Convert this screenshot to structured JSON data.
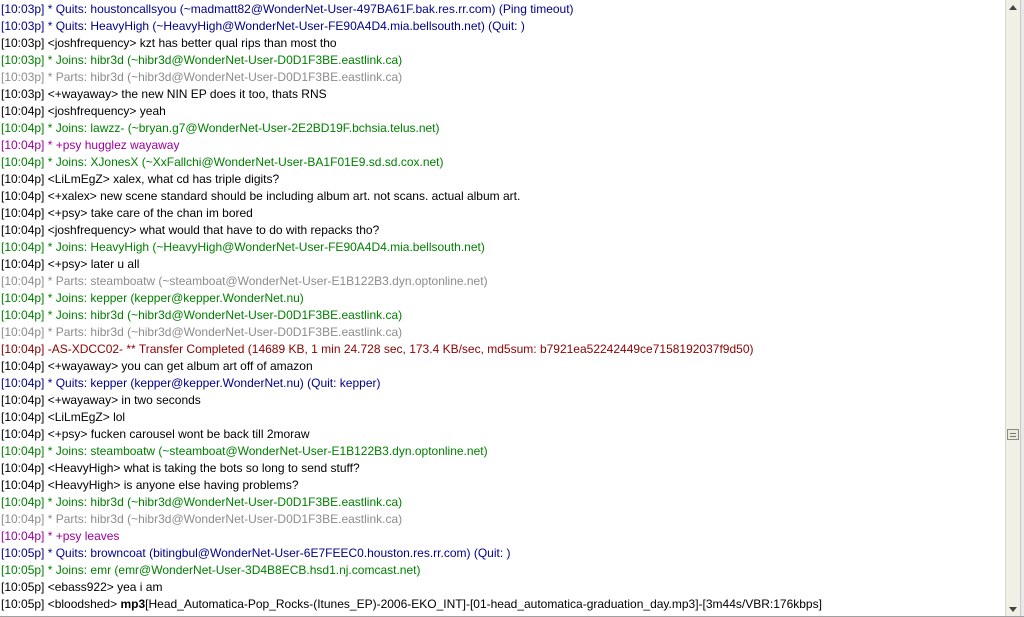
{
  "lines": [
    {
      "ts": "[10:03p]",
      "type": "quit",
      "text": " * Quits: houstoncallsyou (~madmatt82@WonderNet-User-497BA61F.bak.res.rr.com) (Ping timeout)"
    },
    {
      "ts": "[10:03p]",
      "type": "quit",
      "text": " * Quits: HeavyHigh (~HeavyHigh@WonderNet-User-FE90A4D4.mia.bellsouth.net) (Quit: )"
    },
    {
      "ts": "[10:03p]",
      "type": "normal",
      "text": " <joshfrequency> kzt has better qual rips than most tho"
    },
    {
      "ts": "[10:03p]",
      "type": "join",
      "text": " * Joins: hibr3d (~hibr3d@WonderNet-User-D0D1F3BE.eastlink.ca)"
    },
    {
      "ts": "[10:03p]",
      "type": "part",
      "text": " * Parts: hibr3d (~hibr3d@WonderNet-User-D0D1F3BE.eastlink.ca)"
    },
    {
      "ts": "[10:03p]",
      "type": "normal",
      "text": " <+wayaway> the new NIN EP does it too, thats RNS"
    },
    {
      "ts": "[10:04p]",
      "type": "normal",
      "text": " <joshfrequency> yeah"
    },
    {
      "ts": "[10:04p]",
      "type": "join",
      "text": " * Joins: lawzz- (~bryan.g7@WonderNet-User-2E2BD19F.bchsia.telus.net)"
    },
    {
      "ts": "[10:04p]",
      "type": "action",
      "text": " * +psy hugglez wayaway"
    },
    {
      "ts": "[10:04p]",
      "type": "join",
      "text": " * Joins: XJonesX (~XxFallchi@WonderNet-User-BA1F01E9.sd.sd.cox.net)"
    },
    {
      "ts": "[10:04p]",
      "type": "normal",
      "text": " <LiLmEgZ> xalex, what cd has triple digits?"
    },
    {
      "ts": "[10:04p]",
      "type": "normal",
      "text": " <+xalex> new scene standard should be including album art. not scans. actual album art."
    },
    {
      "ts": "[10:04p]",
      "type": "normal",
      "text": " <+psy> take care of the chan im bored"
    },
    {
      "ts": "[10:04p]",
      "type": "normal",
      "text": " <joshfrequency> what would that have to do with repacks tho?"
    },
    {
      "ts": "[10:04p]",
      "type": "join",
      "text": " * Joins: HeavyHigh (~HeavyHigh@WonderNet-User-FE90A4D4.mia.bellsouth.net)"
    },
    {
      "ts": "[10:04p]",
      "type": "normal",
      "text": " <+psy> later u all"
    },
    {
      "ts": "[10:04p]",
      "type": "part",
      "text": " * Parts: steamboatw (~steamboat@WonderNet-User-E1B122B3.dyn.optonline.net)"
    },
    {
      "ts": "[10:04p]",
      "type": "join",
      "text": " * Joins: kepper (kepper@kepper.WonderNet.nu)"
    },
    {
      "ts": "[10:04p]",
      "type": "join",
      "text": " * Joins: hibr3d (~hibr3d@WonderNet-User-D0D1F3BE.eastlink.ca)"
    },
    {
      "ts": "[10:04p]",
      "type": "part",
      "text": " * Parts: hibr3d (~hibr3d@WonderNet-User-D0D1F3BE.eastlink.ca)"
    },
    {
      "ts": "[10:04p]",
      "type": "notice",
      "text": " -AS-XDCC02- ** Transfer Completed (14689 KB, 1 min 24.728 sec, 173.4 KB/sec, md5sum: b7921ea52242449ce7158192037f9d50)"
    },
    {
      "ts": "[10:04p]",
      "type": "normal",
      "text": " <+wayaway> you can get album art off of amazon"
    },
    {
      "ts": "[10:04p]",
      "type": "quit",
      "text": " * Quits: kepper (kepper@kepper.WonderNet.nu) (Quit: kepper)"
    },
    {
      "ts": "[10:04p]",
      "type": "normal",
      "text": " <+wayaway> in two seconds"
    },
    {
      "ts": "[10:04p]",
      "type": "normal",
      "text": " <LiLmEgZ> lol"
    },
    {
      "ts": "[10:04p]",
      "type": "normal",
      "text": " <+psy> fucken carousel wont be back till 2moraw"
    },
    {
      "ts": "[10:04p]",
      "type": "join",
      "text": " * Joins: steamboatw (~steamboat@WonderNet-User-E1B122B3.dyn.optonline.net)"
    },
    {
      "ts": "[10:04p]",
      "type": "normal",
      "text": " <HeavyHigh> what is taking the bots so long to send stuff?"
    },
    {
      "ts": "[10:04p]",
      "type": "normal",
      "text": " <HeavyHigh> is anyone else having problems?"
    },
    {
      "ts": "[10:04p]",
      "type": "join",
      "text": " * Joins: hibr3d (~hibr3d@WonderNet-User-D0D1F3BE.eastlink.ca)"
    },
    {
      "ts": "[10:04p]",
      "type": "part",
      "text": " * Parts: hibr3d (~hibr3d@WonderNet-User-D0D1F3BE.eastlink.ca)"
    },
    {
      "ts": "[10:04p]",
      "type": "action",
      "text": " * +psy leaves"
    },
    {
      "ts": "[10:05p]",
      "type": "quit",
      "text": " * Quits: browncoat (bitingbul@WonderNet-User-6E7FEEC0.houston.res.rr.com) (Quit: )"
    },
    {
      "ts": "[10:05p]",
      "type": "join",
      "text": " * Joins: emr (emr@WonderNet-User-3D4B8ECB.hsd1.nj.comcast.net)"
    },
    {
      "ts": "[10:05p]",
      "type": "normal",
      "text": " <ebass922> yea i am"
    },
    {
      "ts": "[10:05p]",
      "type": "normal",
      "text": " <bloodshed> ",
      "bold": "mp3",
      "rest": "[Head_Automatica-Pop_Rocks-(Itunes_EP)-2006-EKO_INT]-[01-head_automatica-graduation_day.mp3]-[3m44s/VBR:176kbps]"
    }
  ],
  "scrollbar": {
    "up_icon": "arrow-up",
    "down_icon": "arrow-down",
    "position": 0.72
  },
  "colors": {
    "normal": "#000000",
    "quit": "#00008b",
    "join": "#008000",
    "part": "#8c8c8c",
    "action": "#9c009c",
    "notice": "#8b0000"
  }
}
